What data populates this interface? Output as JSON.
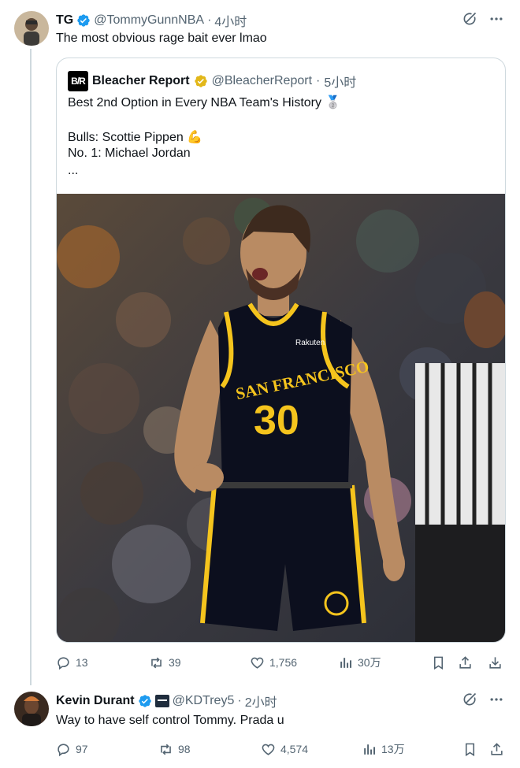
{
  "tweet1": {
    "name": "TG",
    "handle": "@TommyGunnNBA",
    "separator": "·",
    "time": "4小时",
    "text": "The most obvious rage bait ever lmao",
    "quote": {
      "name": "Bleacher Report",
      "logo_text": "B/R",
      "handle": "@BleacherReport",
      "separator": "·",
      "time": "5小时",
      "line1": "Best 2nd Option in Every NBA Team's History",
      "line1_emoji": "🥈",
      "line2": "Bulls: Scottie Pippen",
      "line2_emoji": "💪",
      "line3": "No. 1: Michael Jordan",
      "line4": "...",
      "photo": {
        "jersey_city": "SAN FRANCISCO",
        "jersey_number": "30",
        "sponsor": "Rakuten"
      }
    },
    "actions": {
      "replies": "13",
      "retweets": "39",
      "likes": "1,756",
      "views": "30万"
    }
  },
  "tweet2": {
    "name": "Kevin Durant",
    "handle": "@KDTrey5",
    "separator": "·",
    "time": "2小时",
    "text": "Way to have self control Tommy. Prada u",
    "actions": {
      "replies": "97",
      "retweets": "98",
      "likes": "4,574",
      "views": "13万"
    }
  },
  "colors": {
    "verified_blue": "#1d9bf0",
    "verified_gold": "#e2b719",
    "text_primary": "#0f1419",
    "text_secondary": "#536471",
    "border": "#cfd9de",
    "warriors_navy": "#0c0f1e",
    "warriors_gold": "#f5c41d"
  },
  "icons": [
    "grok-icon",
    "more-icon",
    "reply-icon",
    "retweet-icon",
    "like-icon",
    "views-icon",
    "bookmark-icon",
    "share-icon",
    "download-icon"
  ]
}
